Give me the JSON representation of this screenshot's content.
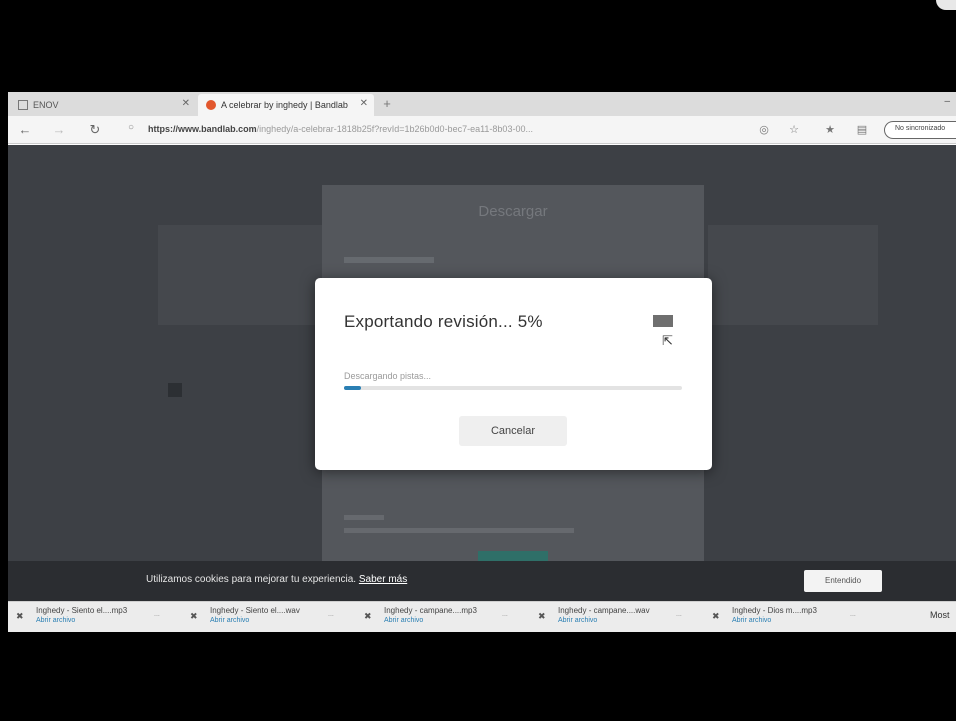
{
  "browser": {
    "tabs": [
      {
        "label": "ENOV"
      },
      {
        "label": "A celebrar by inghedy | Bandlab"
      }
    ],
    "tab_close_glyph": "✕",
    "new_tab_glyph": "+",
    "minimize_glyph": "–",
    "url_host": "https://www.bandlab.com",
    "url_path": "/inghedy/a-celebrar-1818b25f?revId=1b26b0d0-bec7-ea11-8b03-00...",
    "signin_label": "No sincronizado"
  },
  "page": {
    "underlay_title": "Descargar"
  },
  "modal": {
    "title": "Exportando revisión... 5%",
    "progress_label": "Descargando pistas...",
    "progress_percent": 5,
    "cancel_label": "Cancelar"
  },
  "cookie_bar": {
    "text": "Utilizamos cookies para mejorar tu experiencia.",
    "link": "Saber más",
    "button": "Entendido"
  },
  "downloads": [
    {
      "name": "Inghedy - Siento el....mp3",
      "sub": "Abrir archivo"
    },
    {
      "name": "Inghedy - Siento el....wav",
      "sub": "Abrir archivo"
    },
    {
      "name": "Inghedy - campane....mp3",
      "sub": "Abrir archivo"
    },
    {
      "name": "Inghedy - campane....wav",
      "sub": "Abrir archivo"
    },
    {
      "name": "Inghedy - Dios m....mp3",
      "sub": "Abrir archivo"
    }
  ],
  "downloads_more_glyph": "...",
  "downloads_show_all": "Most",
  "icons": {
    "back": "back-arrow-icon",
    "refresh": "refresh-icon",
    "lock": "lock-icon",
    "favorite": "star-icon",
    "collections": "collections-icon",
    "export": "export-icon",
    "cursor": "mouse-cursor-icon"
  },
  "colors": {
    "accent": "#2a7fb3",
    "page_bg": "#3d4045",
    "cookie_bg": "#2b2d31",
    "brand_tab": "#e2572d"
  }
}
